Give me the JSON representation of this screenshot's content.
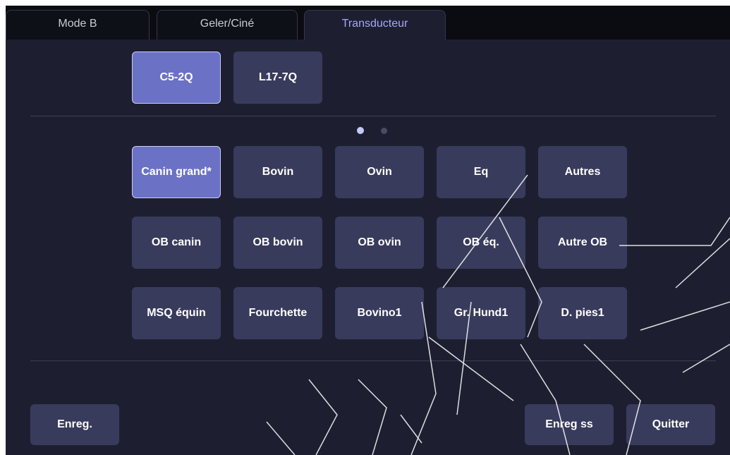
{
  "tabs": [
    {
      "label": "Mode B"
    },
    {
      "label": "Geler/Ciné"
    },
    {
      "label": "Transducteur"
    }
  ],
  "transducers": [
    {
      "label": "C5-2Q",
      "selected": true
    },
    {
      "label": "L17-7Q",
      "selected": false
    }
  ],
  "pagination": {
    "current": 1,
    "total": 2
  },
  "presets": [
    {
      "label": "Canin grand*",
      "selected": true
    },
    {
      "label": "Bovin"
    },
    {
      "label": "Ovin"
    },
    {
      "label": "Eq"
    },
    {
      "label": "Autres"
    },
    {
      "label": "OB canin"
    },
    {
      "label": "OB bovin"
    },
    {
      "label": "OB ovin"
    },
    {
      "label": "OB éq."
    },
    {
      "label": "Autre OB"
    },
    {
      "label": "MSQ équin"
    },
    {
      "label": "Fourchette"
    },
    {
      "label": "Bovino1"
    },
    {
      "label": "Gr. Hund1"
    },
    {
      "label": "D. pies1"
    }
  ],
  "footer": {
    "save_label": "Enreg.",
    "save_as_label": "Enreg ss",
    "quit_label": "Quitter"
  },
  "colors": {
    "background": "#1d1f31",
    "button": "#393b5c",
    "selected": "#6b72c5",
    "active_tab_text": "#a6a8f4"
  }
}
